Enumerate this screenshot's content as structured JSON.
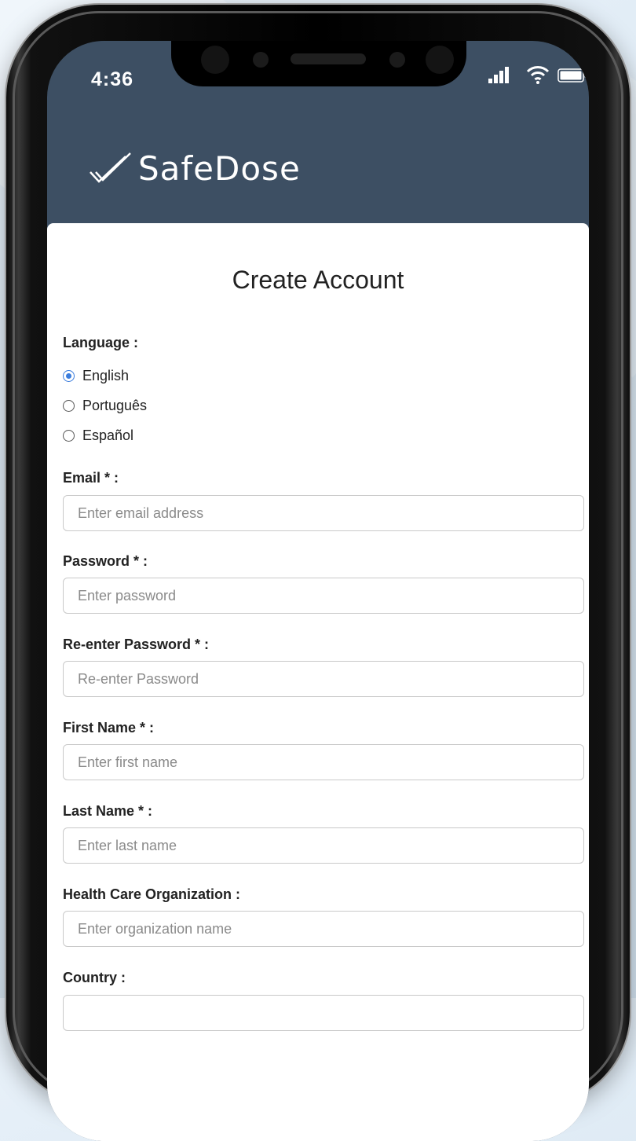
{
  "status_bar": {
    "time": "4:36",
    "icons": [
      "cellular-signal-icon",
      "wifi-icon",
      "battery-icon"
    ]
  },
  "header": {
    "brand_name": "SafeDose",
    "logo_icon": "double-check-icon"
  },
  "form": {
    "title": "Create Account",
    "language": {
      "label": "Language :",
      "options": [
        {
          "label": "English",
          "selected": true
        },
        {
          "label": "Português",
          "selected": false
        },
        {
          "label": "Español",
          "selected": false
        }
      ]
    },
    "email": {
      "label": "Email * :",
      "placeholder": "Enter email address",
      "value": ""
    },
    "password": {
      "label": "Password * :",
      "placeholder": "Enter password",
      "value": ""
    },
    "reenter_password": {
      "label": "Re-enter Password * :",
      "placeholder": "Re-enter Password",
      "value": ""
    },
    "first_name": {
      "label": "First Name * :",
      "placeholder": "Enter first name",
      "value": ""
    },
    "last_name": {
      "label": "Last Name * :",
      "placeholder": "Enter last name",
      "value": ""
    },
    "organization": {
      "label": "Health Care Organization :",
      "placeholder": "Enter organization name",
      "value": ""
    },
    "country": {
      "label": "Country :"
    }
  },
  "colors": {
    "header_bg": "#3d4f63",
    "radio_accent": "#3b7ddd",
    "card_bg": "#ffffff"
  }
}
